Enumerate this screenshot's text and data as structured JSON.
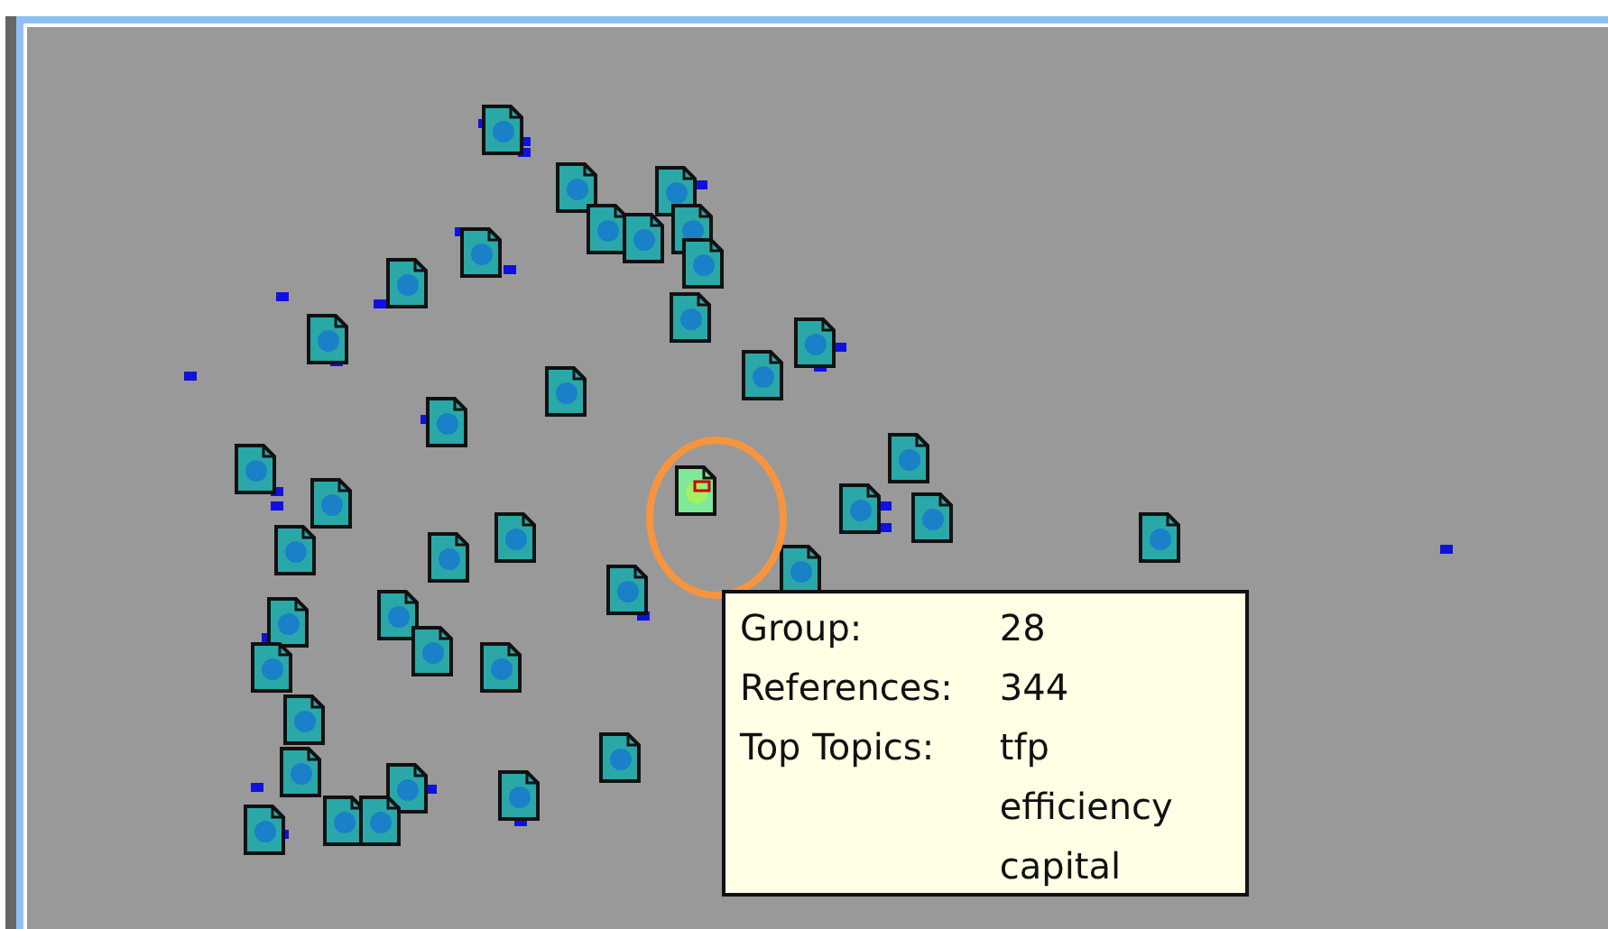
{
  "documents": [
    {
      "selected": false
    },
    {
      "selected": false
    },
    {
      "selected": false
    },
    {
      "selected": false
    },
    {
      "selected": false
    },
    {
      "selected": false
    },
    {
      "selected": false
    },
    {
      "selected": false
    },
    {
      "selected": false
    },
    {
      "selected": false
    },
    {
      "selected": false
    },
    {
      "selected": false
    },
    {
      "selected": false
    },
    {
      "selected": false
    },
    {
      "selected": false
    },
    {
      "selected": false
    },
    {
      "selected": false
    },
    {
      "selected": false
    },
    {
      "selected": false
    },
    {
      "selected": false
    },
    {
      "selected": false
    },
    {
      "selected": false
    },
    {
      "selected": false
    },
    {
      "selected": false
    },
    {
      "selected": false
    },
    {
      "selected": false
    },
    {
      "selected": false
    },
    {
      "selected": false
    },
    {
      "selected": false
    },
    {
      "selected": false
    },
    {
      "selected": false
    },
    {
      "selected": false
    },
    {
      "selected": false
    },
    {
      "selected": false
    },
    {
      "selected": false
    },
    {
      "selected": false
    },
    {
      "selected": false
    },
    {
      "selected": false
    },
    {
      "selected": false
    },
    {
      "selected": true
    }
  ],
  "tooltip": {
    "rows": [
      {
        "label": "Group:",
        "values": [
          "28"
        ]
      },
      {
        "label": "References:",
        "values": [
          "344"
        ]
      },
      {
        "label": "Top Topics:",
        "values": [
          "tfp",
          "efficiency",
          "capital"
        ]
      }
    ]
  }
}
